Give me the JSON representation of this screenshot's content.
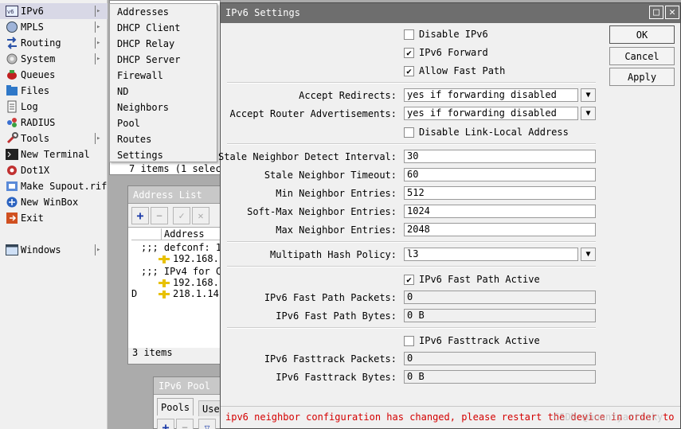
{
  "sidebar": {
    "items": [
      {
        "label": "IPv6",
        "icon": "ipv6-icon",
        "submenu": true,
        "active": true
      },
      {
        "label": "MPLS",
        "icon": "mpls-icon",
        "submenu": true
      },
      {
        "label": "Routing",
        "icon": "routing-icon",
        "submenu": true
      },
      {
        "label": "System",
        "icon": "system-gear-icon",
        "submenu": true
      },
      {
        "label": "Queues",
        "icon": "queues-icon",
        "submenu": false
      },
      {
        "label": "Files",
        "icon": "files-folder-icon",
        "submenu": false
      },
      {
        "label": "Log",
        "icon": "log-icon",
        "submenu": false
      },
      {
        "label": "RADIUS",
        "icon": "radius-icon",
        "submenu": false
      },
      {
        "label": "Tools",
        "icon": "tools-icon",
        "submenu": true
      },
      {
        "label": "New Terminal",
        "icon": "terminal-icon",
        "submenu": false
      },
      {
        "label": "Dot1X",
        "icon": "dot1x-icon",
        "submenu": false
      },
      {
        "label": "Make Supout.rif",
        "icon": "supout-icon",
        "submenu": false
      },
      {
        "label": "New WinBox",
        "icon": "winbox-icon",
        "submenu": false
      },
      {
        "label": "Exit",
        "icon": "exit-icon",
        "submenu": false
      },
      {
        "label": "Windows",
        "icon": "windows-icon",
        "submenu": true
      }
    ]
  },
  "submenu": {
    "items": [
      "Addresses",
      "DHCP Client",
      "DHCP Relay",
      "DHCP Server",
      "Firewall",
      "ND",
      "Neighbors",
      "Pool",
      "Routes",
      "Settings"
    ]
  },
  "bg_top": {
    "row_fragment": "7 items (1 selec"
  },
  "address_list": {
    "title": "Address List",
    "column_header": "Address",
    "rows": [
      {
        "flag": "",
        "text": ";;; defconf: 1"
      },
      {
        "flag": "",
        "text": "192.168."
      },
      {
        "flag": "",
        "text": ";;; IPv4 for C"
      },
      {
        "flag": "",
        "text": "192.168."
      },
      {
        "flag": "D",
        "text": "218.1.14"
      }
    ],
    "footer": "3 items"
  },
  "pool_window": {
    "title": "IPv6 Pool",
    "tabs": [
      "Pools",
      "Used"
    ]
  },
  "dialog": {
    "title": "IPv6 Settings",
    "buttons": {
      "ok": "OK",
      "cancel": "Cancel",
      "apply": "Apply"
    },
    "disable_ipv6": {
      "label": "Disable IPv6",
      "checked": false
    },
    "ipv6_forward": {
      "label": "IPv6 Forward",
      "checked": true
    },
    "allow_fast_path": {
      "label": "Allow Fast Path",
      "checked": true
    },
    "accept_redirects": {
      "label": "Accept Redirects:",
      "value": "yes if forwarding disabled"
    },
    "accept_ra": {
      "label": "Accept Router Advertisements:",
      "value": "yes if forwarding disabled"
    },
    "disable_link_local": {
      "label": "Disable Link-Local Address",
      "checked": false
    },
    "stale_detect": {
      "label": "Stale Neighbor Detect Interval:",
      "value": "30"
    },
    "stale_timeout": {
      "label": "Stale Neighbor Timeout:",
      "value": "60"
    },
    "min_entries": {
      "label": "Min Neighbor Entries:",
      "value": "512"
    },
    "softmax_entries": {
      "label": "Soft-Max Neighbor Entries:",
      "value": "1024"
    },
    "max_entries": {
      "label": "Max Neighbor Entries:",
      "value": "2048"
    },
    "multipath": {
      "label": "Multipath Hash Policy:",
      "value": "l3"
    },
    "fastpath_active": {
      "label": "IPv6 Fast Path Active",
      "checked": true
    },
    "fastpath_packets": {
      "label": "IPv6 Fast Path Packets:",
      "value": "0"
    },
    "fastpath_bytes": {
      "label": "IPv6 Fast Path Bytes:",
      "value": "0 B"
    },
    "fasttrack_active": {
      "label": "IPv6 Fasttrack Active",
      "checked": false
    },
    "fasttrack_packets": {
      "label": "IPv6 Fasttrack Packets:",
      "value": "0"
    },
    "fasttrack_bytes": {
      "label": "IPv6 Fasttrack Bytes:",
      "value": "0 B"
    },
    "status": "ipv6 neighbor configuration has changed, please restart the device in order to",
    "watermark": "CSDN @bountyartisky"
  },
  "colors": {
    "status_red": "#d40000",
    "title_gray": "#6e6e6e"
  }
}
